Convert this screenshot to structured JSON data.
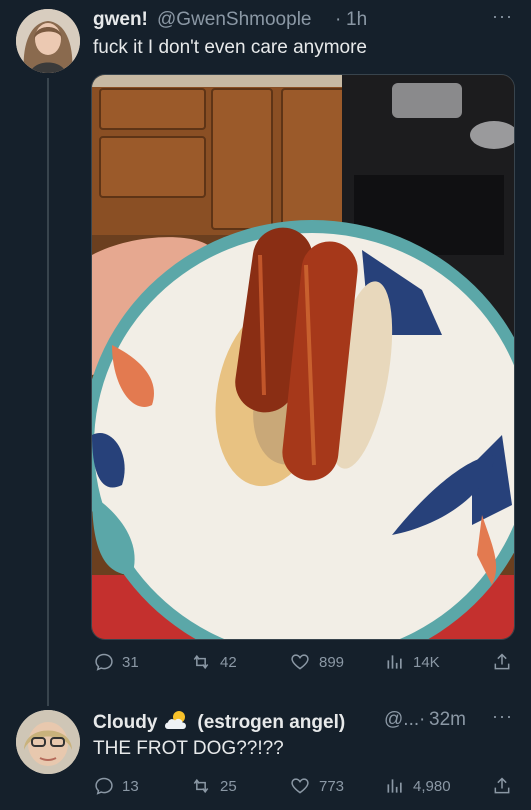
{
  "tweet1": {
    "display_name": "gwen!",
    "handle": "@GwenShmoople",
    "separator": "·",
    "time": "1h",
    "text": "fuck it I don't even care anymore",
    "stats": {
      "replies": "31",
      "retweets": "42",
      "likes": "899",
      "views": "14K"
    }
  },
  "tweet2": {
    "display_name": "Cloudy",
    "emoji_icon": "sun-behind-cloud-icon",
    "display_name_suffix": "(estrogen angel)",
    "handle": "@...",
    "separator": "·",
    "time": "32m",
    "text": "THE FROT DOG??!??",
    "stats": {
      "replies": "13",
      "retweets": "25",
      "likes": "773",
      "views": "4,980"
    }
  },
  "colors": {
    "background": "#15202b",
    "text": "#e7e9ea",
    "muted": "#8b98a5",
    "divider": "#38444d"
  }
}
